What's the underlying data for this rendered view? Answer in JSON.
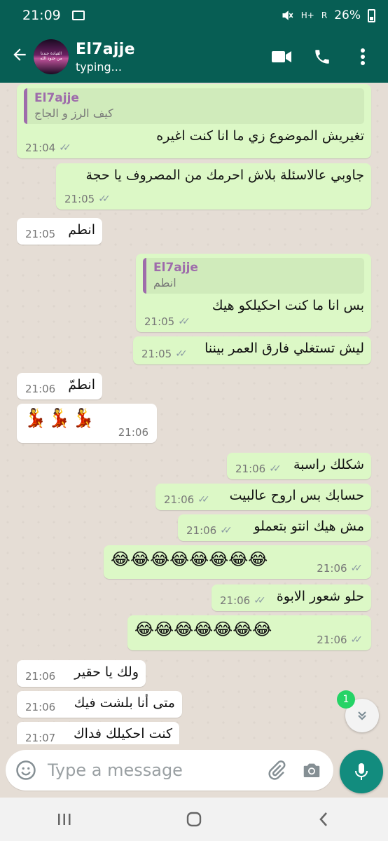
{
  "status_bar": {
    "time": "21:09",
    "network": "H+",
    "signal": "R",
    "battery": "26%"
  },
  "header": {
    "contact_name": "El7ajje",
    "status": "typing...",
    "avatar_text": "القيادة جندنا من جنود الله"
  },
  "messages": [
    {
      "id": "m1",
      "dir": "out",
      "quote_name": "El7ajje",
      "quote_text": "كيف الرز و الجاج",
      "text": "تغيريش الموضوع زي ما انا كنت اغيره",
      "time": "21:04",
      "ticks": "✓✓"
    },
    {
      "id": "m2",
      "dir": "out",
      "text": "جاوبي عالاسئلة بلاش احرمك من المصروف يا حجة",
      "time": "21:05",
      "ticks": "✓✓"
    },
    {
      "id": "m3",
      "dir": "in",
      "text": "انطم",
      "time": "21:05"
    },
    {
      "id": "m4",
      "dir": "out",
      "quote_name": "El7ajje",
      "quote_text": "انطم",
      "text": "بس انا ما كنت احكيلكو هيك",
      "time": "21:05",
      "ticks": "✓✓"
    },
    {
      "id": "m5",
      "dir": "out",
      "text": "ليش تستغلي فارق العمر بيننا",
      "time": "21:05",
      "ticks": "✓✓"
    },
    {
      "id": "m6",
      "dir": "in",
      "text": "انطمّ",
      "time": "21:06"
    },
    {
      "id": "m7",
      "dir": "in",
      "text": "💃💃💃",
      "time": "21:06"
    },
    {
      "id": "m8",
      "dir": "out",
      "text": "شكلك راسبة",
      "time": "21:06",
      "ticks": "✓✓"
    },
    {
      "id": "m9",
      "dir": "out",
      "text": "حسابك بس اروح عالبيت",
      "time": "21:06",
      "ticks": "✓✓"
    },
    {
      "id": "m10",
      "dir": "out",
      "text": "مش هيك انتو بتعملو",
      "time": "21:06",
      "ticks": "✓✓"
    },
    {
      "id": "m11",
      "dir": "out",
      "text": "😂😂😂😂😂😂😂😂",
      "time": "21:06",
      "ticks": "✓✓"
    },
    {
      "id": "m12",
      "dir": "out",
      "text": "حلو شعور الابوة",
      "time": "21:06",
      "ticks": "✓✓"
    },
    {
      "id": "m13",
      "dir": "out",
      "text": "😂😂😂😂😂😂😂",
      "time": "21:06",
      "ticks": "✓✓"
    },
    {
      "id": "m14",
      "dir": "in",
      "text": "ولك يا حقير",
      "time": "21:06"
    },
    {
      "id": "m15",
      "dir": "in",
      "text": "متى أنا بلشت فيك",
      "time": "21:06"
    },
    {
      "id": "m16",
      "dir": "in",
      "text": "كنت احكيلك فداك",
      "time": "21:07"
    }
  ],
  "unread_count": "1",
  "composer": {
    "placeholder": "Type a message"
  },
  "icons": {
    "back": "arrow-left-icon",
    "video": "video-call-icon",
    "call": "phone-icon",
    "menu": "more-vert-icon",
    "emoji": "emoji-icon",
    "attach": "paperclip-icon",
    "camera": "camera-icon",
    "mic": "mic-icon",
    "scroll": "chevron-double-down-icon"
  },
  "colors": {
    "header": "#075e54",
    "outgoing": "#dcf8c6",
    "incoming": "#ffffff",
    "accent": "#128c7e",
    "quote_bar": "#9e6cab",
    "badge": "#25d366"
  }
}
